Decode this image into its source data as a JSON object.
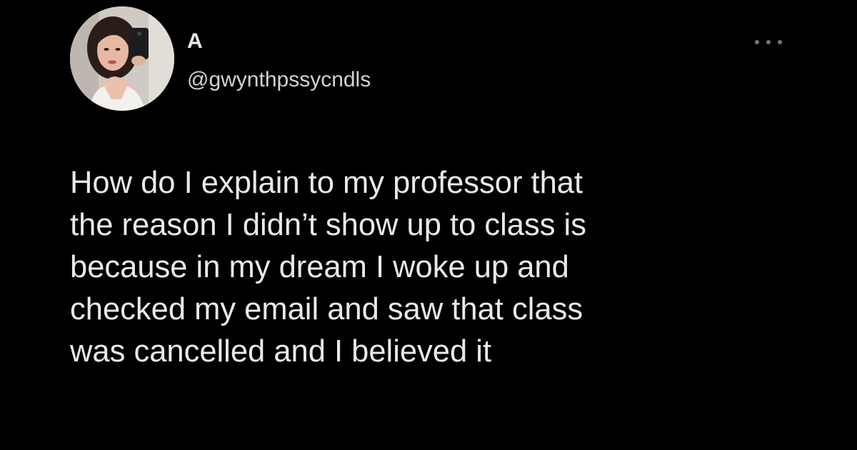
{
  "author": {
    "display_name": "A",
    "handle": "@gwynthpssycndls",
    "avatar_icon": "profile-photo"
  },
  "menu": {
    "icon": "more-options-icon"
  },
  "tweet": {
    "lines": [
      "How do I explain to my professor that",
      "the reason I didn’t show up to class is",
      "because in my dream I woke up and",
      "checked my email and saw that class",
      "was cancelled and I believed it"
    ]
  },
  "colors": {
    "background": "#000000",
    "text": "#e7e9ea"
  }
}
